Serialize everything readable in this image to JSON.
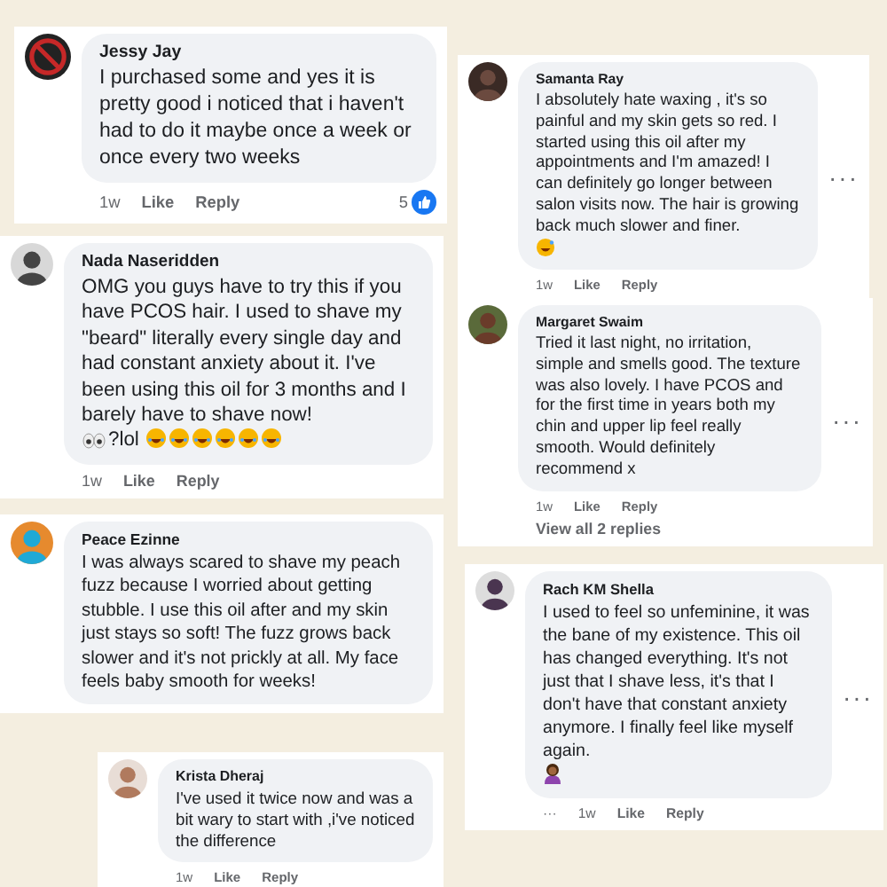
{
  "comments": [
    {
      "name": "Jessy Jay",
      "body": [
        {
          "kind": "text",
          "text": "I purchased some and yes it is pretty good i noticed that i haven't had to do it maybe once a week or once every two weeks"
        }
      ],
      "footer": {
        "time": "1w",
        "like": "Like",
        "reply": "Reply"
      },
      "reactions": "5"
    },
    {
      "name": "Samanta Ray",
      "body": [
        {
          "kind": "text",
          "text": "I absolutely hate waxing , it's so painful and my skin gets so red. I started using this oil after my appointments and I'm amazed! I can definitely go longer between salon visits now. The hair is growing back much slower and finer."
        },
        {
          "kind": "sweat"
        }
      ],
      "footer": {
        "time": "1w",
        "like": "Like",
        "reply": "Reply"
      },
      "more": "···"
    },
    {
      "name": "Nada Naseridden",
      "body": [
        {
          "kind": "text",
          "text": "OMG you guys have to try this if you have PCOS hair. I used to shave my \"beard\" literally every single day and had constant anxiety about it. I've been using this oil for 3 months and I barely have to shave now!"
        },
        {
          "kind": "eyes"
        },
        {
          "kind": "text",
          "text": "?lol "
        },
        {
          "kind": "laugh"
        },
        {
          "kind": "laugh"
        },
        {
          "kind": "laugh"
        },
        {
          "kind": "laugh"
        },
        {
          "kind": "laugh"
        },
        {
          "kind": "laugh"
        }
      ],
      "footer": {
        "time": "1w",
        "like": "Like",
        "reply": "Reply"
      }
    },
    {
      "name": "Margaret Swaim",
      "body": [
        {
          "kind": "text",
          "text": "Tried it last night, no irritation, simple and smells good. The texture was also lovely. I have PCOS and for the first time in years both my chin and upper lip feel really smooth. Would definitely recommend x"
        }
      ],
      "footer": {
        "time": "1w",
        "like": "Like",
        "reply": "Reply"
      },
      "more": "···",
      "replies": "View all 2 replies"
    },
    {
      "name": "Peace Ezinne",
      "body": [
        {
          "kind": "text",
          "text": "I was always scared to shave my peach fuzz because I worried about getting stubble. I use this oil after and my skin just stays so soft! The fuzz grows back slower and it's not prickly at all. My face feels baby smooth for weeks!"
        }
      ]
    },
    {
      "name": "Krista Dheraj",
      "body": [
        {
          "kind": "text",
          "text": "I've used it twice now and was a bit wary to start with ,i've noticed the difference"
        }
      ],
      "footer": {
        "time": "1w",
        "like": "Like",
        "reply": "Reply"
      }
    },
    {
      "name": "Rach KM Shella",
      "body": [
        {
          "kind": "text",
          "text": "I used to feel so unfeminine, it was the bane of my existence. This oil has changed everything. It's not just that I shave less, it's that I don't have that constant anxiety anymore. I finally feel like myself again."
        },
        {
          "kind": "person"
        }
      ],
      "footer": {
        "lead": "···",
        "time": "1w",
        "like": "Like",
        "reply": "Reply"
      },
      "more": "···"
    }
  ]
}
